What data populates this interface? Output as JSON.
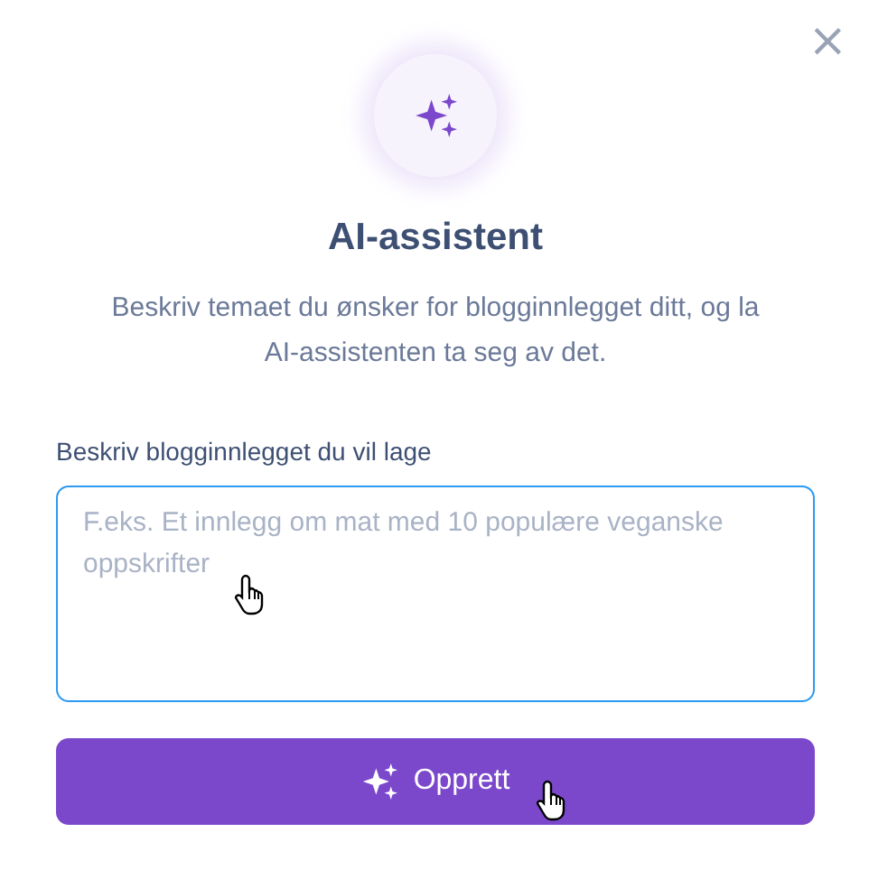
{
  "dialog": {
    "close": "×",
    "title": "AI-assistent",
    "description": "Beskriv temaet du ønsker for blogginnlegget ditt, og la AI-assistenten ta seg av det.",
    "field": {
      "label": "Beskriv blogginnlegget du vil lage",
      "placeholder": "F.eks. Et innlegg om mat med 10 populære veganske oppskrifter",
      "focused": true
    },
    "submit": {
      "label": "Opprett"
    }
  }
}
